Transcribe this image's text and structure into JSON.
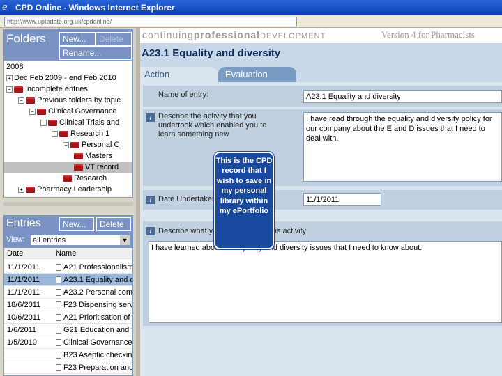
{
  "window": {
    "title": "CPD Online - Windows Internet Explorer",
    "url": "http://www.uptodate.org.uk/cpdonline/"
  },
  "folders": {
    "title": "Folders",
    "new_label": "New...",
    "delete_label": "Delete",
    "rename_label": "Rename...",
    "tree": [
      {
        "label": "2008",
        "expander": ""
      },
      {
        "label": "Dec Feb 2009 - end Feb 2010",
        "expander": "+"
      },
      {
        "label": "Incomplete entries",
        "expander": "−"
      },
      {
        "label": "Previous folders by topic",
        "expander": "−"
      },
      {
        "label": "Clinical Governance",
        "expander": "−"
      },
      {
        "label": "Clinical Trials and",
        "expander": "−"
      },
      {
        "label": "Research 1",
        "expander": "−"
      },
      {
        "label": "Personal C",
        "expander": "−"
      },
      {
        "label": "Masters",
        "expander": ""
      },
      {
        "label": "VT record",
        "expander": ""
      },
      {
        "label": "Research",
        "expander": ""
      },
      {
        "label": "Pharmacy Leadership",
        "expander": "+"
      }
    ]
  },
  "entries": {
    "title": "Entries",
    "new_label": "New...",
    "delete_label": "Delete",
    "view_label": "View:",
    "view_value": "all entries",
    "columns": [
      "Date",
      "Name"
    ],
    "rows": [
      {
        "date": "11/1/2011",
        "name": "A21 Professionalism"
      },
      {
        "date": "11/1/2011",
        "name": "A23.1 Equality and di"
      },
      {
        "date": "11/1/2011",
        "name": "A23.2 Personal comp"
      },
      {
        "date": "18/6/2011",
        "name": "F23 Dispensing servi"
      },
      {
        "date": "10/6/2011",
        "name": "A21 Prioritisation of w"
      },
      {
        "date": "1/6/2011",
        "name": "G21 Education and tr"
      },
      {
        "date": "1/5/2010",
        "name": "Clinical Governance"
      },
      {
        "date": "",
        "name": "B23 Aseptic checking"
      },
      {
        "date": "",
        "name": "F23 Preparation and c"
      }
    ]
  },
  "brand": {
    "logo_part1": "continuing",
    "logo_part2": "professional",
    "logo_part3": "DEVELOPMENT",
    "version": "Version 4 for Pharmacists"
  },
  "entry": {
    "title": "A23.1 Equality and diversity",
    "tabs": [
      "Action",
      "Evaluation"
    ],
    "fields": {
      "name_label": "Name of entry:",
      "name_value": "A23.1 Equality and diversity",
      "describe_label": "Describe the activity that you undertook which enabled you to learn something new",
      "describe_value": "I have read through the equality and diversity policy for our company about the E and D issues that I need to deal with.",
      "date_label": "Date Undertaken",
      "date_value": "11/1/2011",
      "learned_label": "Describe what you learned from this activity",
      "learned_value": "I have learned about the equality and diversity issues that I need to know about."
    }
  },
  "callout": {
    "text": "This is the CPD record that I wish to save in my personal library within my ePortfolio"
  }
}
